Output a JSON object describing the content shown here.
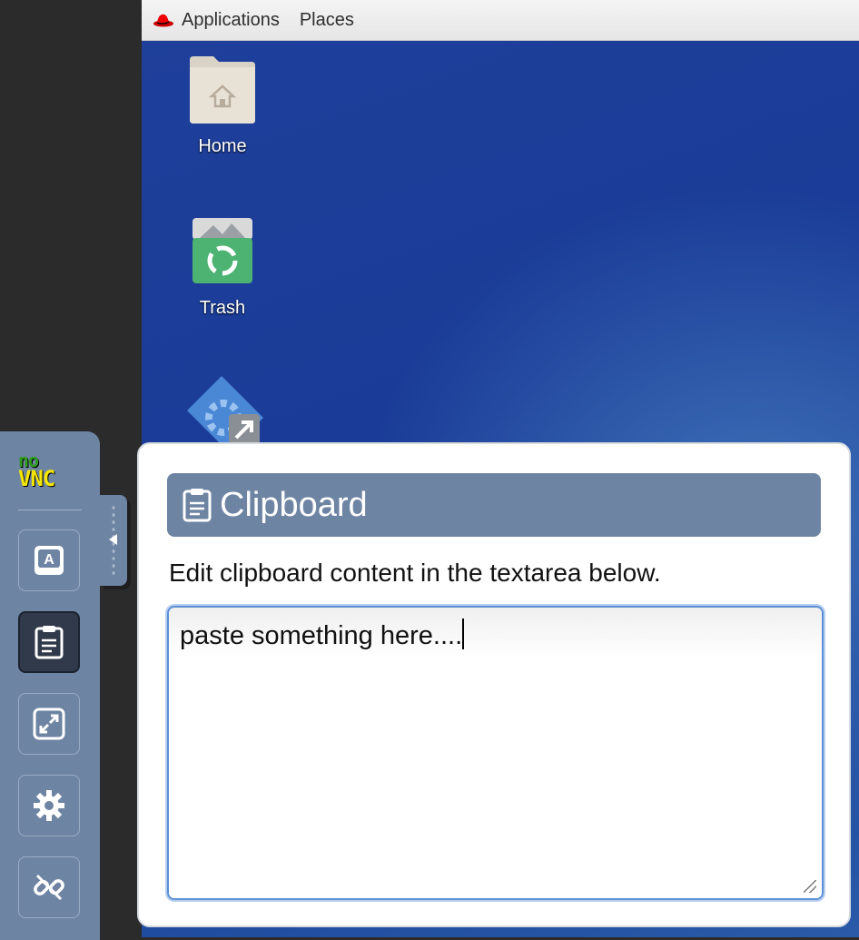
{
  "topbar": {
    "applications": "Applications",
    "places": "Places"
  },
  "desktop": {
    "icons": [
      {
        "label": "Home"
      },
      {
        "label": "Trash"
      }
    ]
  },
  "novnc": {
    "logo_top": "no",
    "logo_bottom": "VNC",
    "buttons": [
      {
        "name": "extra-keys",
        "icon": "keyboard-a-icon"
      },
      {
        "name": "clipboard",
        "icon": "clipboard-icon",
        "active": true
      },
      {
        "name": "fullscreen",
        "icon": "fullscreen-icon"
      },
      {
        "name": "settings",
        "icon": "gear-icon"
      },
      {
        "name": "disconnect",
        "icon": "disconnect-icon"
      }
    ]
  },
  "clipboard": {
    "title": "Clipboard",
    "description": "Edit clipboard content in the textarea below.",
    "content": "paste something here...."
  },
  "colors": {
    "panel_header": "#6e84a3",
    "sidebar": "#6e84a3",
    "desktop": "#1e3f9a",
    "focus_ring": "#5c8fd6"
  }
}
